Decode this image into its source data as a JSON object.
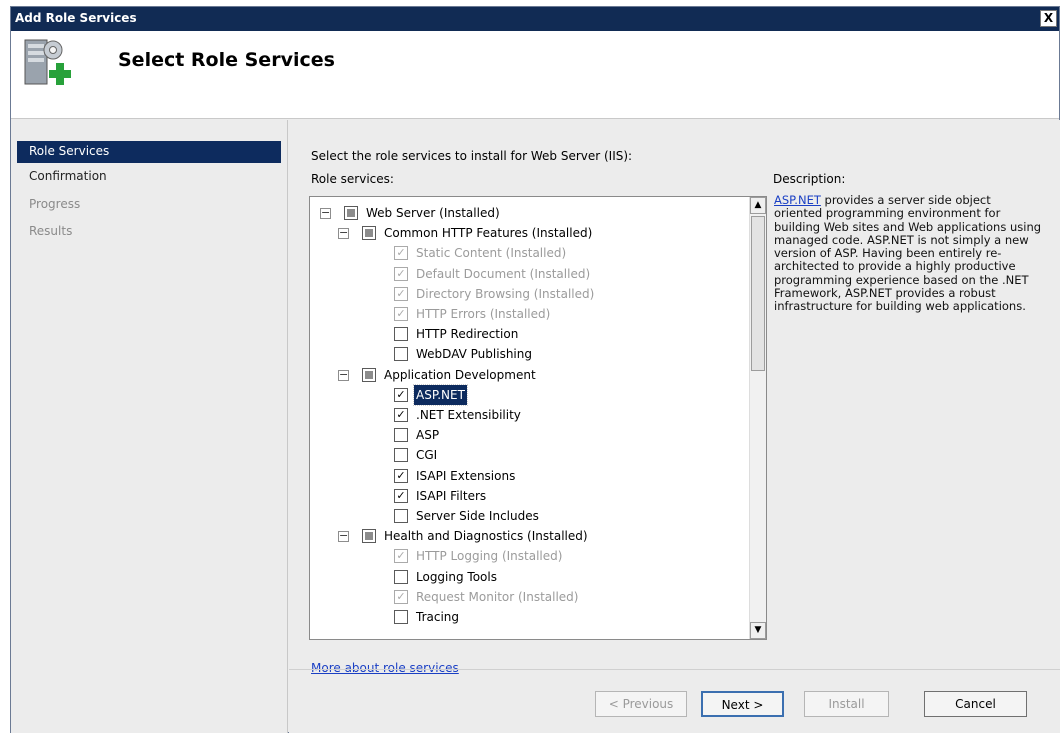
{
  "window": {
    "title": "Add Role Services",
    "close_label": "X"
  },
  "header": {
    "title": "Select Role Services",
    "icon": "server-add-icon"
  },
  "sidebar": {
    "items": [
      {
        "label": "Role Services",
        "state": "active"
      },
      {
        "label": "Confirmation",
        "state": "normal"
      },
      {
        "label": "Progress",
        "state": "dim"
      },
      {
        "label": "Results",
        "state": "dim"
      }
    ]
  },
  "main": {
    "intro": "Select the role services to install for Web Server (IIS):",
    "role_services_label": "Role services:",
    "description_heading": "Description:",
    "description_link": "ASP.NET",
    "description_text": " provides a server side object oriented programming environment for building Web sites and Web applications using managed code. ASP.NET is not simply a new version of ASP. Having been entirely re-architected to provide a highly productive programming experience based on the .NET Framework, ASP.NET provides a robust infrastructure for building web applications.",
    "more_link": "More about role services"
  },
  "tree": [
    {
      "label": "Web Server  (Installed)",
      "level": 0,
      "expander": "-",
      "check": "partial"
    },
    {
      "label": "Common HTTP Features  (Installed)",
      "level": 1,
      "expander": "-",
      "check": "partial"
    },
    {
      "label": "Static Content  (Installed)",
      "level": 2,
      "check": "installed"
    },
    {
      "label": "Default Document  (Installed)",
      "level": 2,
      "check": "installed"
    },
    {
      "label": "Directory Browsing  (Installed)",
      "level": 2,
      "check": "installed"
    },
    {
      "label": "HTTP Errors  (Installed)",
      "level": 2,
      "check": "installed"
    },
    {
      "label": "HTTP Redirection",
      "level": 2,
      "check": "unchecked"
    },
    {
      "label": "WebDAV Publishing",
      "level": 2,
      "check": "unchecked"
    },
    {
      "label": "Application Development",
      "level": 1,
      "expander": "-",
      "check": "partial"
    },
    {
      "label": "ASP.NET",
      "level": 2,
      "check": "checked",
      "selected": true
    },
    {
      "label": ".NET Extensibility",
      "level": 2,
      "check": "checked"
    },
    {
      "label": "ASP",
      "level": 2,
      "check": "unchecked"
    },
    {
      "label": "CGI",
      "level": 2,
      "check": "unchecked"
    },
    {
      "label": "ISAPI Extensions",
      "level": 2,
      "check": "checked"
    },
    {
      "label": "ISAPI Filters",
      "level": 2,
      "check": "checked"
    },
    {
      "label": "Server Side Includes",
      "level": 2,
      "check": "unchecked"
    },
    {
      "label": "Health and Diagnostics  (Installed)",
      "level": 1,
      "expander": "-",
      "check": "partial"
    },
    {
      "label": "HTTP Logging  (Installed)",
      "level": 2,
      "check": "installed"
    },
    {
      "label": "Logging Tools",
      "level": 2,
      "check": "unchecked"
    },
    {
      "label": "Request Monitor  (Installed)",
      "level": 2,
      "check": "installed"
    },
    {
      "label": "Tracing",
      "level": 2,
      "check": "unchecked"
    }
  ],
  "scrollbar": {
    "up_arrow": "▲",
    "down_arrow": "▼"
  },
  "buttons": {
    "previous": "< Previous",
    "next": "Next >",
    "install": "Install",
    "cancel": "Cancel"
  }
}
